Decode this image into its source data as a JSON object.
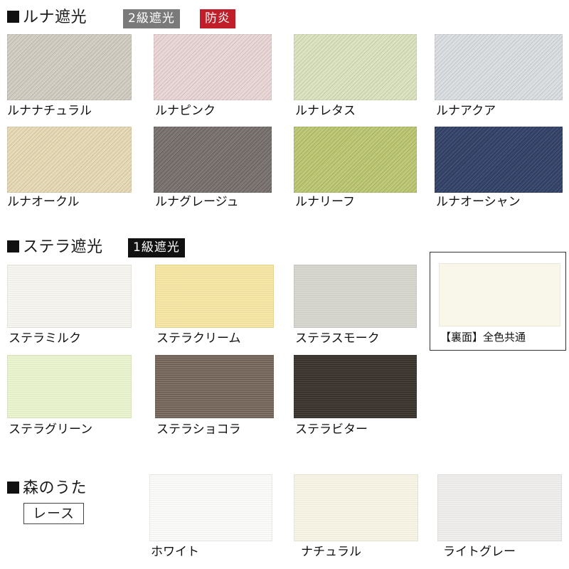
{
  "luna": {
    "title": "ルナ遮光",
    "badge_grade": "2級遮光",
    "badge_fire": "防炎",
    "swatches": [
      {
        "name": "ルナナチュラル",
        "color": "#cfcbc0"
      },
      {
        "name": "ルナピンク",
        "color": "#e9d4d4"
      },
      {
        "name": "ルナレタス",
        "color": "#d9e2bc"
      },
      {
        "name": "ルナアクア",
        "color": "#d9dde0"
      },
      {
        "name": "ルナオークル",
        "color": "#e5d8b2"
      },
      {
        "name": "ルナグレージュ",
        "color": "#7a7370"
      },
      {
        "name": "ルナリーフ",
        "color": "#b9c46d"
      },
      {
        "name": "ルナオーシャン",
        "color": "#35446b"
      }
    ]
  },
  "stella": {
    "title": "ステラ遮光",
    "badge_grade": "1級遮光",
    "swatches": [
      {
        "name": "ステラミルク",
        "color": "#f6f5ef"
      },
      {
        "name": "ステラクリーム",
        "color": "#f6e7a6"
      },
      {
        "name": "ステラスモーク",
        "color": "#d7d6cf"
      },
      {
        "name": "ステラグリーン",
        "color": "#eaf4cf"
      },
      {
        "name": "ステラショコラ",
        "color": "#7a6b5f"
      },
      {
        "name": "ステラビター",
        "color": "#3c342e"
      }
    ],
    "back": {
      "label": "【裏面】全色共通",
      "color": "#f8f7e9"
    }
  },
  "mori": {
    "title": "森のうた",
    "badge_lace": "レース",
    "swatches": [
      {
        "name": "ホワイト",
        "color": "#fbfbfa"
      },
      {
        "name": "ナチュラル",
        "color": "#f8f5e6"
      },
      {
        "name": "ライトグレー",
        "color": "#efeeec"
      }
    ]
  }
}
